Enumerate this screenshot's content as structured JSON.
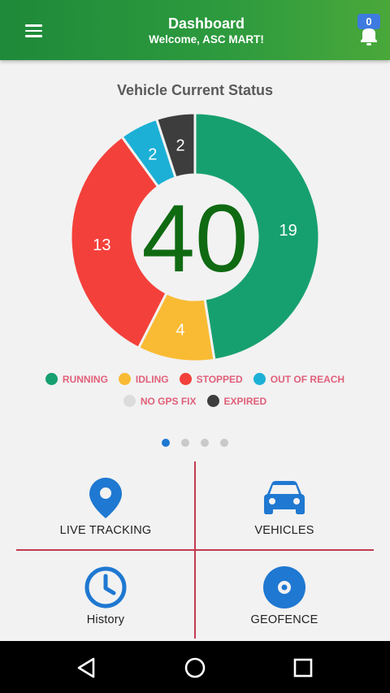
{
  "header": {
    "title": "Dashboard",
    "subtitle": "Welcome, ASC MART!",
    "notification_count": "0"
  },
  "chart_data": {
    "type": "pie",
    "title": "Vehicle Current Status",
    "center_label": "40",
    "slices": [
      {
        "label": "RUNNING",
        "value": 19,
        "color": "#17a06f"
      },
      {
        "label": "IDLING",
        "value": 4,
        "color": "#f9bb33"
      },
      {
        "label": "STOPPED",
        "value": 13,
        "color": "#f4403a"
      },
      {
        "label": "OUT OF REACH",
        "value": 2,
        "color": "#1cb0d6"
      },
      {
        "label": "EXPIRED",
        "value": 2,
        "color": "#3d3d3d"
      }
    ],
    "legend": [
      {
        "label": "RUNNING",
        "color": "#17a06f"
      },
      {
        "label": "IDLING",
        "color": "#f9bb33"
      },
      {
        "label": "STOPPED",
        "color": "#f4403a"
      },
      {
        "label": "OUT OF REACH",
        "color": "#1cb0d6"
      },
      {
        "label": "NO GPS FIX",
        "color": "#dcdcdc"
      },
      {
        "label": "EXPIRED",
        "color": "#3d3d3d"
      }
    ]
  },
  "pager": {
    "page_count": 4,
    "active_page": 1
  },
  "tiles": {
    "live_tracking": "LIVE TRACKING",
    "vehicles": "VEHICLES",
    "history": "History",
    "geofence": "GEOFENCE"
  },
  "colors": {
    "accent": "#1f78d1",
    "header": "#2e9b3e",
    "center_number": "#0f6a12",
    "divider": "#c23a4e",
    "legend_text": "#e0607a"
  }
}
